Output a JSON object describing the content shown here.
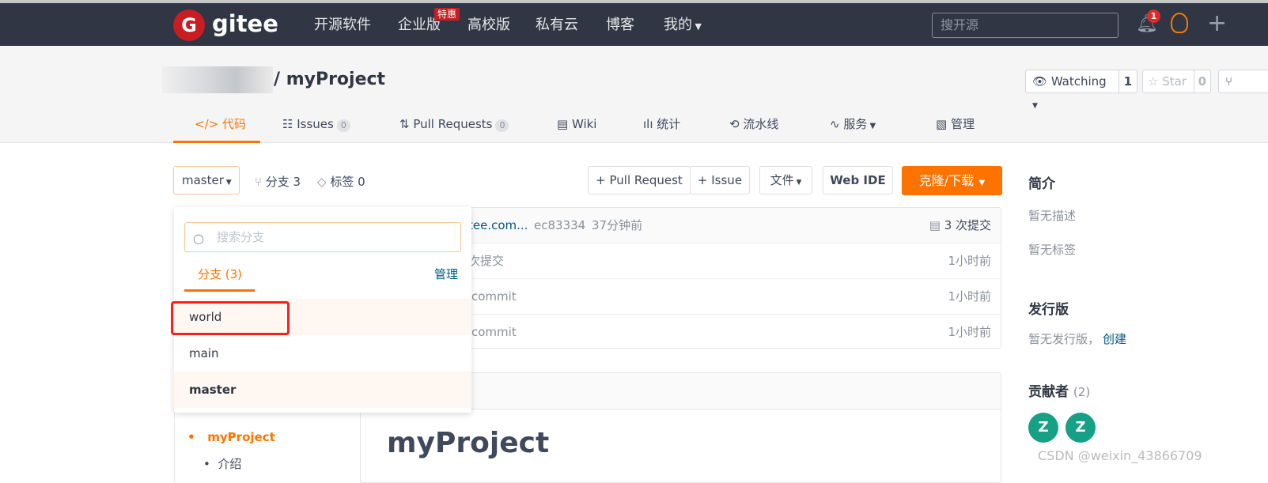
{
  "nav": {
    "logo_letter": "G",
    "logo_text": "gitee",
    "items": [
      "开源软件",
      "企业版",
      "高校版",
      "私有云",
      "博客",
      "我的"
    ],
    "hot_badge": "特惠",
    "search_placeholder": "搜开源",
    "notification_count": "1"
  },
  "repo": {
    "title": "/ myProject",
    "watch_label": "Watching",
    "watch_count": "1",
    "star_label": "Star",
    "star_count": "0"
  },
  "tabs": [
    {
      "label": "代码",
      "active": true
    },
    {
      "label": "Issues",
      "count": "0"
    },
    {
      "label": "Pull Requests",
      "count": "0"
    },
    {
      "label": "Wiki"
    },
    {
      "label": "统计"
    },
    {
      "label": "流水线"
    },
    {
      "label": "服务"
    },
    {
      "label": "管理"
    }
  ],
  "toolbar": {
    "branch": "master",
    "branches": "分支 3",
    "tags": "标签 0",
    "pull_request": "+ Pull Request",
    "issue": "+ Issue",
    "file": "文件",
    "webide": "Web IDE",
    "clone": "克隆/下载"
  },
  "commits": {
    "author_link": "tee.com...",
    "hash": "ec83334",
    "time": "37分钟前",
    "total": "3 次提交",
    "rows": [
      {
        "msg": "次提交",
        "time": "1小时前"
      },
      {
        "msg": "commit",
        "time": "1小时前"
      },
      {
        "msg": "commit",
        "time": "1小时前"
      }
    ]
  },
  "dropdown": {
    "search_placeholder": "搜索分支",
    "tab": "分支 (3)",
    "manage": "管理",
    "branches": [
      "world",
      "main",
      "master"
    ]
  },
  "readme": {
    "title": "myProject"
  },
  "tree": {
    "items": [
      "myProject",
      "介绍"
    ]
  },
  "sidebar": {
    "intro_title": "简介",
    "no_desc": "暂无描述",
    "no_tags": "暂无标签",
    "release_title": "发行版",
    "no_release": "暂无发行版，",
    "create": "创建",
    "contrib_title": "贡献者",
    "contrib_count": "(2)",
    "avatars": [
      "Z",
      "Z"
    ]
  },
  "watermark": "CSDN @weixin_43866709"
}
